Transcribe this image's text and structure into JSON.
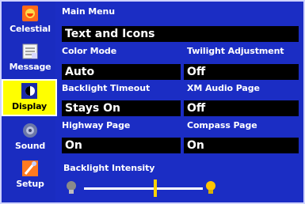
{
  "sidebar": {
    "items": [
      {
        "label": "Celestial"
      },
      {
        "label": "Message"
      },
      {
        "label": "Display"
      },
      {
        "label": "Sound"
      },
      {
        "label": "Setup"
      }
    ]
  },
  "main": {
    "menu_label": "Main Menu",
    "menu_value": "Text and Icons",
    "color_mode_label": "Color Mode",
    "color_mode_value": "Auto",
    "twilight_label": "Twilight Adjustment",
    "twilight_value": "Off",
    "backlight_timeout_label": "Backlight Timeout",
    "backlight_timeout_value": "Stays On",
    "xm_audio_label": "XM Audio Page",
    "xm_audio_value": "Off",
    "highway_label": "Highway Page",
    "highway_value": "On",
    "compass_label": "Compass Page",
    "compass_value": "On",
    "backlight_intensity_label": "Backlight Intensity",
    "backlight_intensity_level": 0.6
  },
  "colors": {
    "background": "#1b2dc4",
    "selected_tab": "#ffff00",
    "field": "#000000",
    "slider_thumb": "#ffd200"
  }
}
